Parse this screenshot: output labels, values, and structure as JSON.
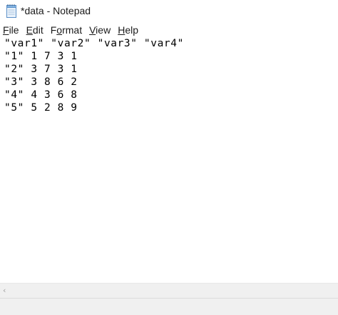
{
  "window": {
    "title": "*data - Notepad",
    "icon": "notepad-icon"
  },
  "menubar": {
    "items": [
      {
        "label": "File",
        "accel": "F",
        "rest": "ile"
      },
      {
        "label": "Edit",
        "accel": "E",
        "rest": "dit"
      },
      {
        "label": "Format",
        "accel": "o",
        "pre": "F",
        "rest": "rmat"
      },
      {
        "label": "View",
        "accel": "V",
        "rest": "iew"
      },
      {
        "label": "Help",
        "accel": "H",
        "rest": "elp"
      }
    ]
  },
  "editor": {
    "lines": [
      "\"var1\" \"var2\" \"var3\" \"var4\"",
      "\"1\" 1 7 3 1",
      "\"2\" 3 7 3 1",
      "\"3\" 3 8 6 2",
      "\"4\" 4 3 6 8",
      "\"5\" 5 2 8 9"
    ]
  },
  "scrollbar": {
    "left_arrow_icon": "chevron-left-icon",
    "left_arrow_glyph": "‹"
  }
}
